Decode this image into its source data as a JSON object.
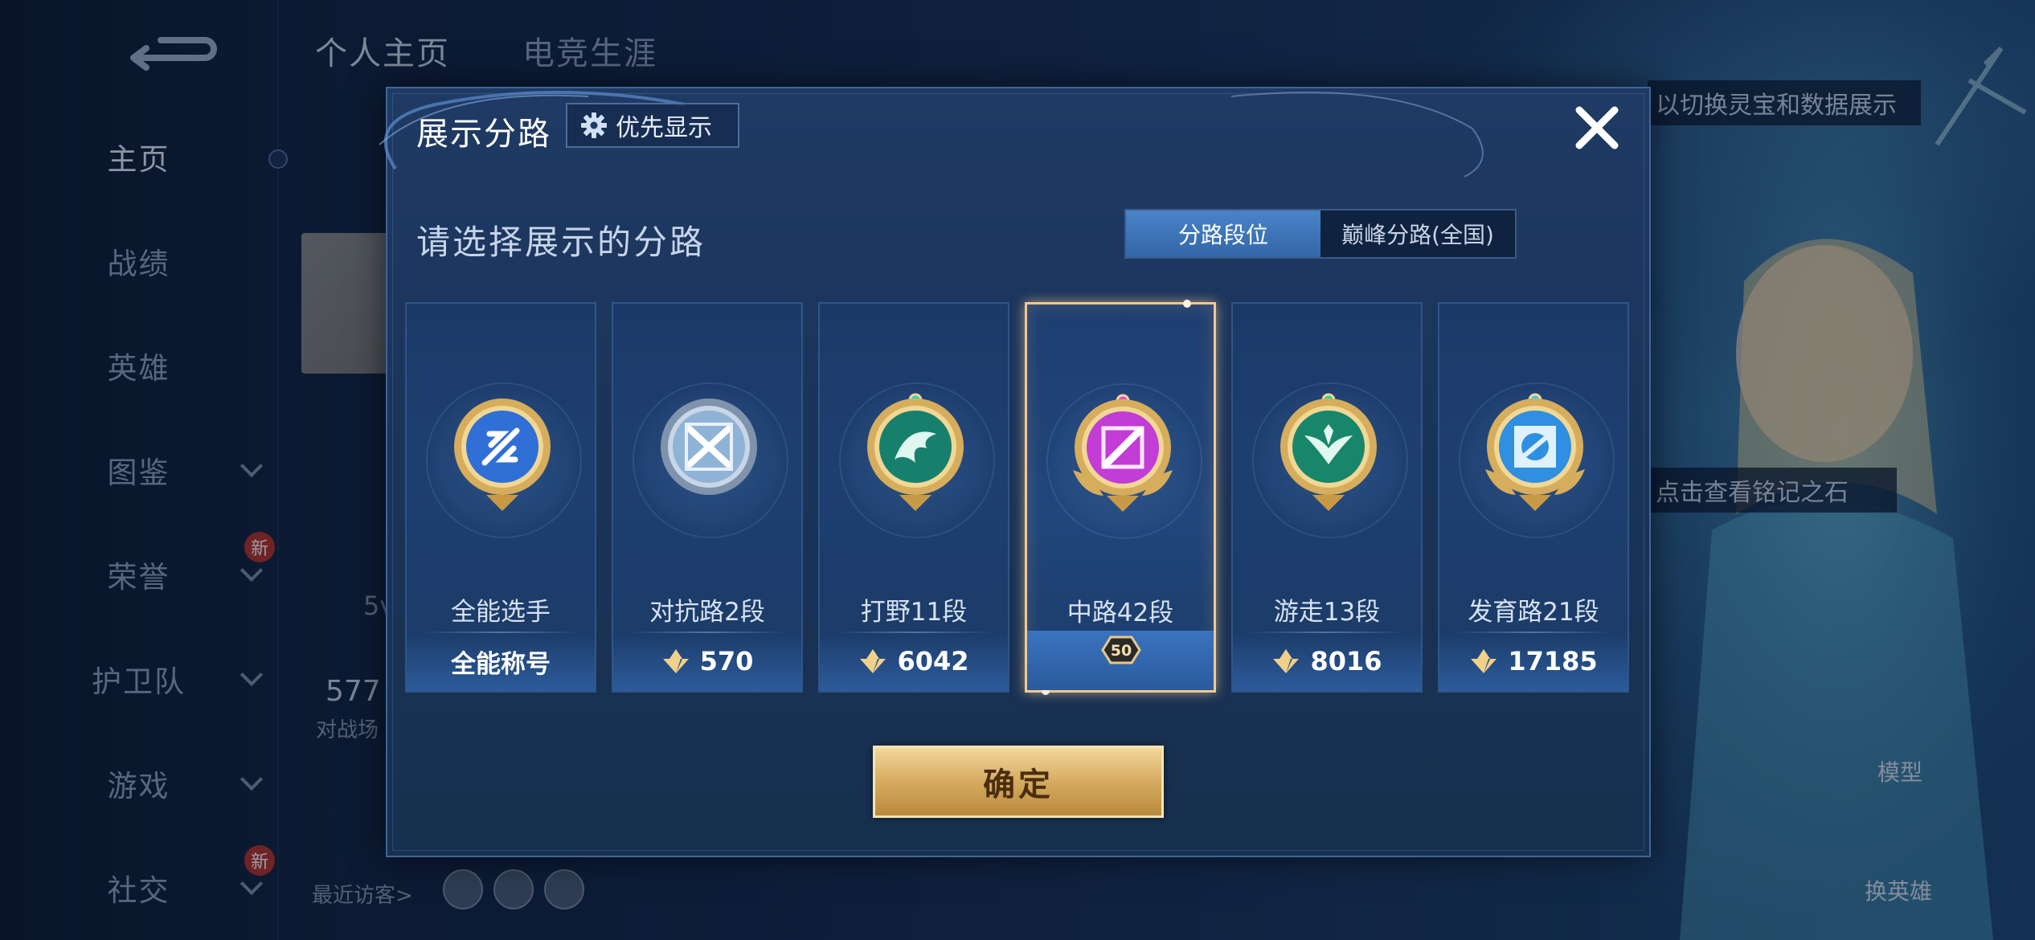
{
  "background": {
    "top_tabs": [
      "个人主页",
      "电竞生涯"
    ],
    "sidebar": [
      {
        "label": "主页",
        "active": true,
        "has_chevron": false
      },
      {
        "label": "战绩",
        "active": false,
        "has_chevron": false
      },
      {
        "label": "英雄",
        "active": false,
        "has_chevron": false
      },
      {
        "label": "图鉴",
        "active": false,
        "has_chevron": true
      },
      {
        "label": "荣誉",
        "active": false,
        "has_chevron": true
      },
      {
        "label": "护卫队",
        "active": false,
        "has_chevron": true
      },
      {
        "label": "游戏",
        "active": false,
        "has_chevron": true
      },
      {
        "label": "社交",
        "active": false,
        "has_chevron": true
      }
    ],
    "new_badge": "新",
    "partial_texts": [
      "5v",
      "577",
      "对战场"
    ],
    "recent_visitors_label": "最近访客>",
    "right_banner_top": "以切换灵宝和数据展示",
    "right_banner_mid": "点击查看铭记之石",
    "model_label": "模型",
    "switch_hero_label": "换英雄"
  },
  "dialog": {
    "title": "展示分路",
    "priority_button": "优先显示",
    "subtitle": "请选择展示的分路",
    "tabs": [
      {
        "label": "分路段位",
        "active": true
      },
      {
        "label": "巅峰分路(全国)",
        "active": false
      }
    ],
    "cards": [
      {
        "name": "全能选手",
        "bottom_label": "全能称号",
        "score": null,
        "emblem": "allround-emblem-icon",
        "color": "#2f6fd6",
        "selected": false
      },
      {
        "name": "对抗路2段",
        "bottom_label": null,
        "score": "570",
        "emblem": "clash-lane-emblem-icon",
        "color": "#8fb3d6",
        "selected": false
      },
      {
        "name": "打野11段",
        "bottom_label": null,
        "score": "6042",
        "emblem": "jungle-emblem-icon",
        "color": "#17806d",
        "selected": false
      },
      {
        "name": "中路42段",
        "bottom_label": null,
        "score": null,
        "emblem": "mid-lane-emblem-icon",
        "color": "#c23cd6",
        "selected": true,
        "badge": "50"
      },
      {
        "name": "游走13段",
        "bottom_label": null,
        "score": "8016",
        "emblem": "roam-emblem-icon",
        "color": "#18866b",
        "selected": false
      },
      {
        "name": "发育路21段",
        "bottom_label": null,
        "score": "17185",
        "emblem": "farm-lane-emblem-icon",
        "color": "#2f8fe0",
        "selected": false
      }
    ],
    "confirm_button": "确定"
  }
}
